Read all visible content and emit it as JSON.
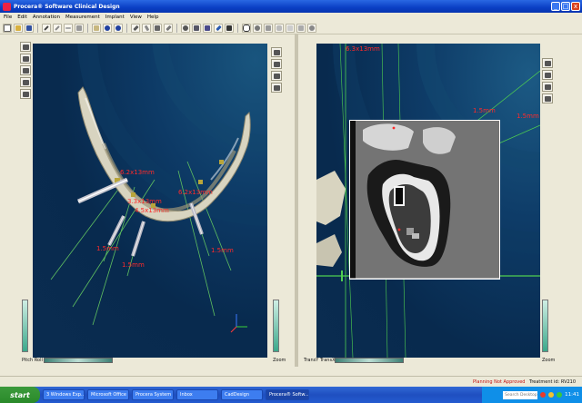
{
  "window": {
    "title": "Procera® Software Clinical Design",
    "buttons": [
      "_",
      "□",
      "x"
    ]
  },
  "menu": [
    "File",
    "Edit",
    "Annotation",
    "Measurement",
    "Implant",
    "View",
    "Help"
  ],
  "left_view": {
    "measurements": [
      "6.2x13mm",
      "3.3x13mm",
      "6.2x13mm",
      "4.5x13mm",
      "1.5mm",
      "1.5mm",
      "1.5mm"
    ],
    "slider_label": "Pitch Roll",
    "zoom_label": "Zoom"
  },
  "right_view": {
    "measurements": [
      "6.3x13mm",
      "1.5mm",
      "1.5mm"
    ],
    "slider_label": "TransY TransX",
    "zoom_label": "Zoom"
  },
  "status": {
    "warning": "Planning Not Approved",
    "treatment": "Treatment id: RV210"
  },
  "taskbar": {
    "start_label": "start",
    "tasks": [
      "3 Windows Exp...",
      "Microsoft Office ...",
      "Procera System ...",
      "Inbox",
      "CadDesign",
      "Procera® Softw..."
    ],
    "search_placeholder": "Search Desktop",
    "clock": "11:41"
  }
}
